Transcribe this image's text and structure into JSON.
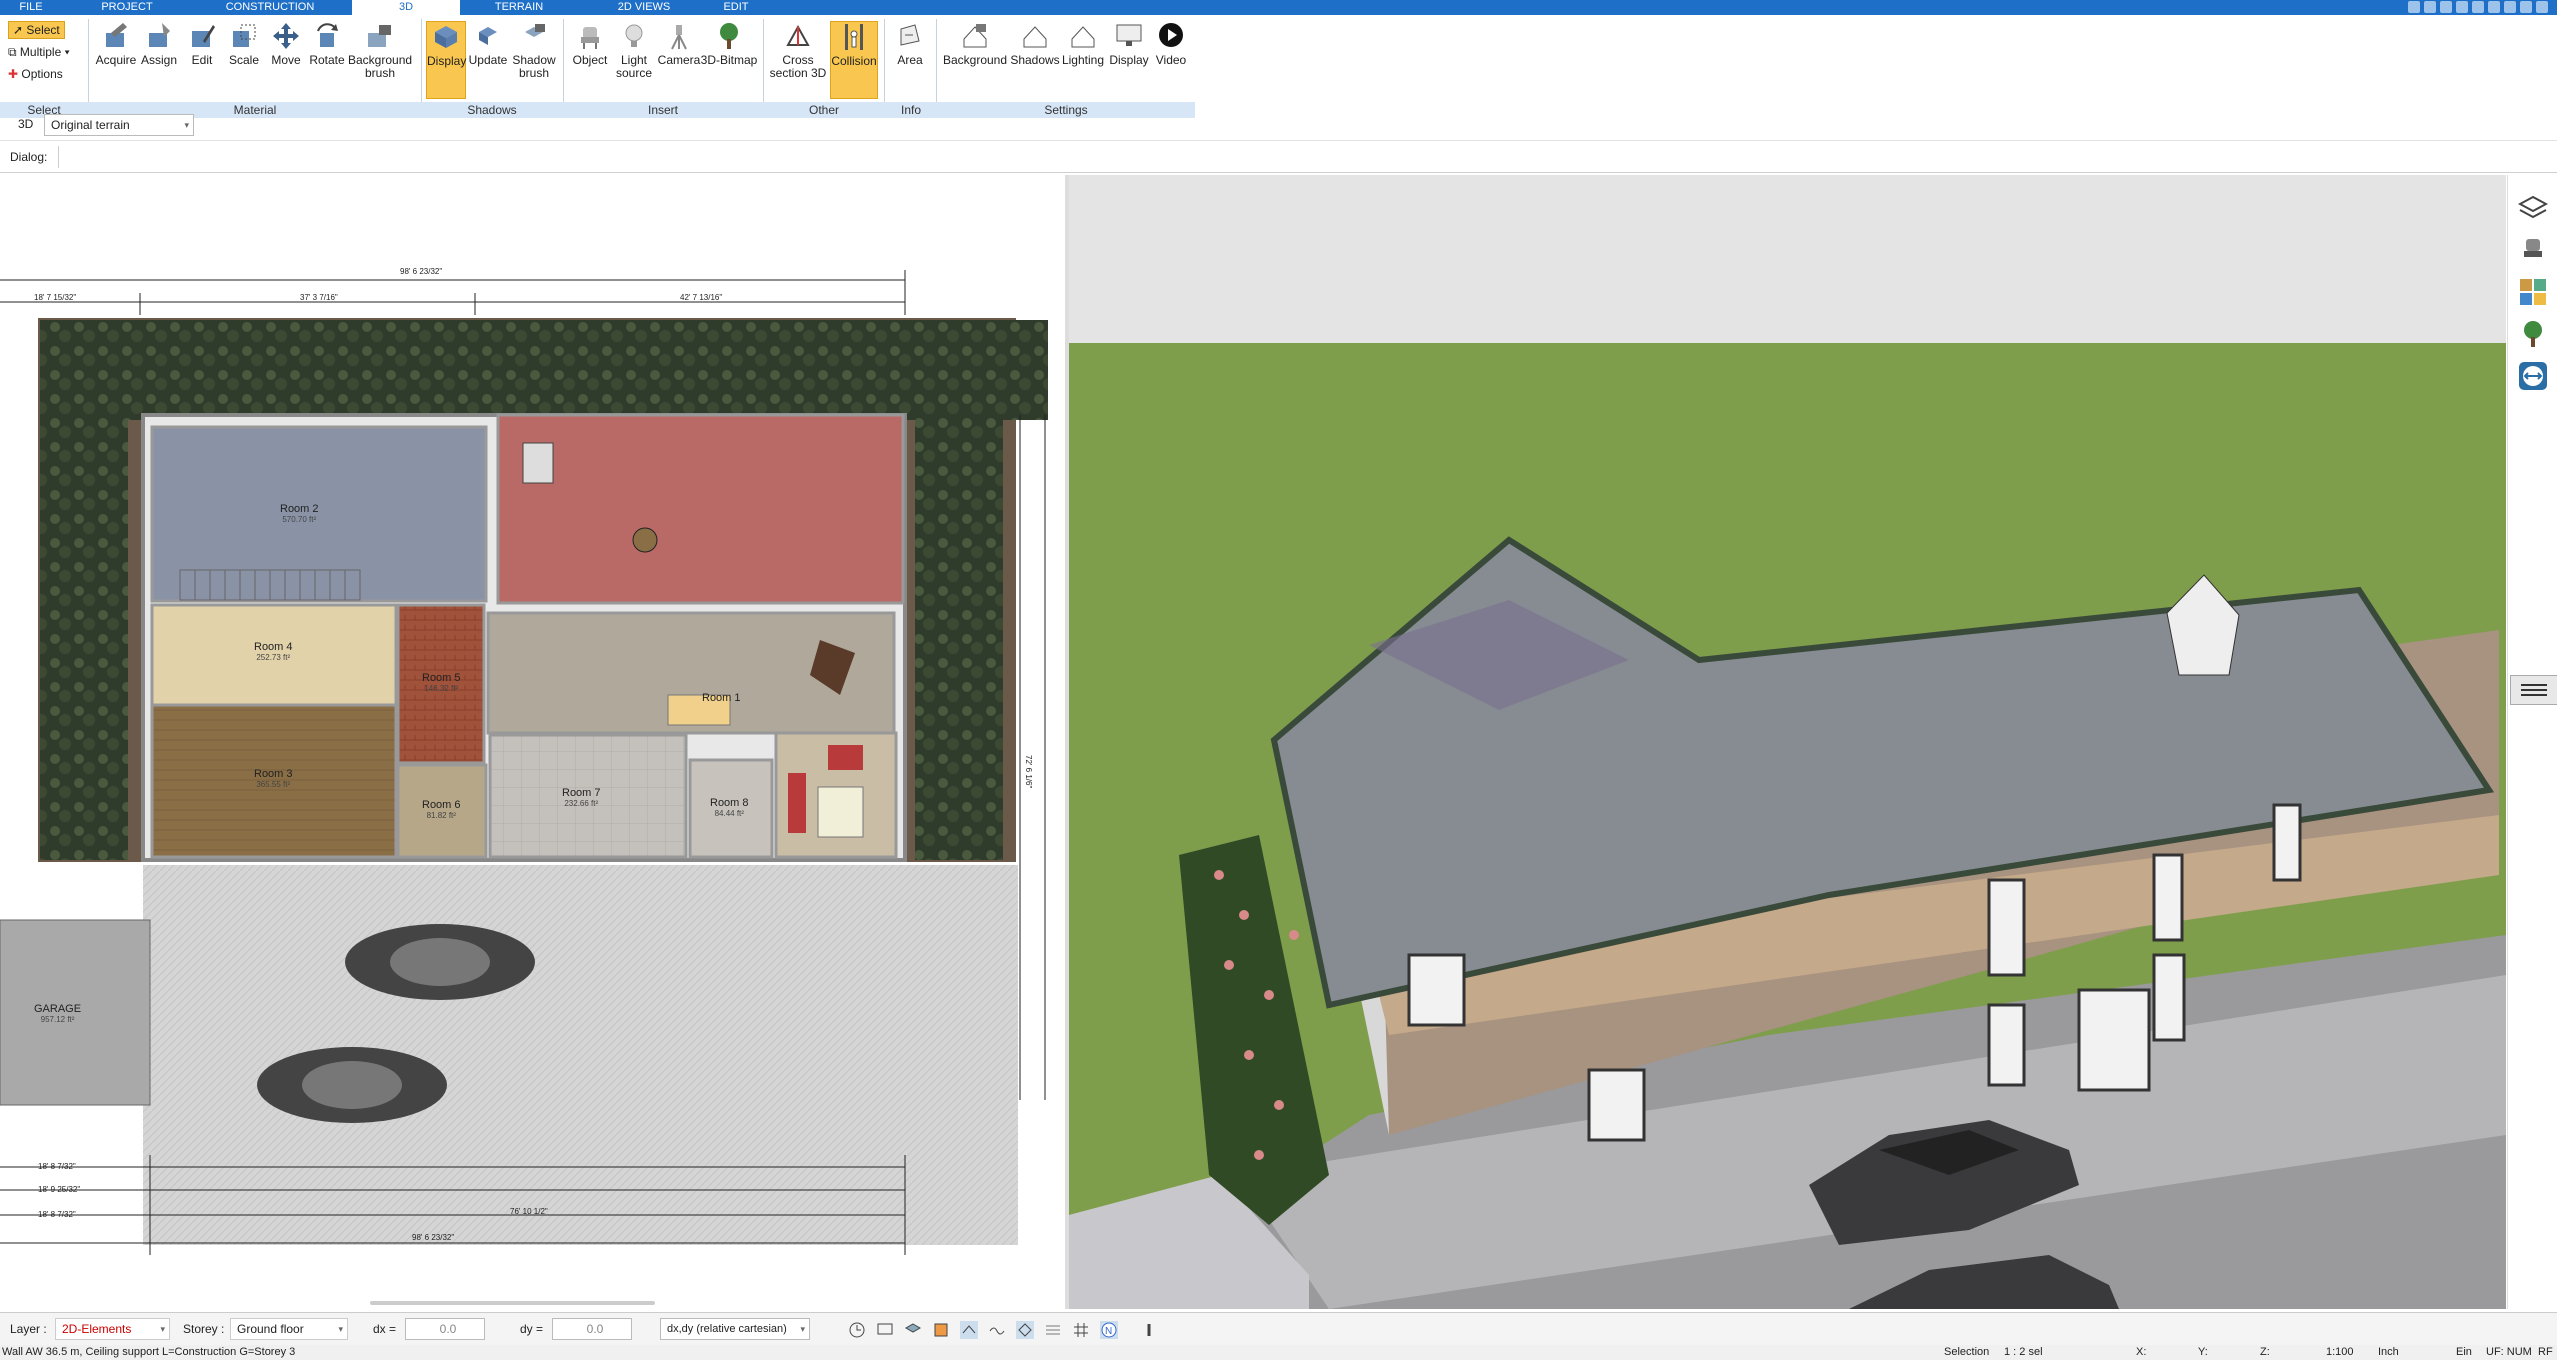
{
  "tabs": [
    {
      "label": "FILE"
    },
    {
      "label": "PROJECT"
    },
    {
      "label": "CONSTRUCTION"
    },
    {
      "label": "3D"
    },
    {
      "label": "TERRAIN"
    },
    {
      "label": "2D VIEWS"
    },
    {
      "label": "EDIT"
    }
  ],
  "ribbon": {
    "select": {
      "select": "Select",
      "multiple": "Multiple",
      "options": "Options"
    },
    "tools": [
      {
        "label": "Acquire",
        "icon": "acquire-icon"
      },
      {
        "label": "Assign",
        "icon": "assign-icon"
      },
      {
        "label": "Edit",
        "icon": "edit-icon"
      },
      {
        "label": "Scale",
        "icon": "scale-icon"
      },
      {
        "label": "Move",
        "icon": "move-icon"
      },
      {
        "label": "Rotate",
        "icon": "rotate-icon"
      },
      {
        "label": "Background brush",
        "icon": "background-brush-icon"
      },
      {
        "label": "Display",
        "icon": "display-shadows-icon"
      },
      {
        "label": "Update",
        "icon": "update-icon"
      },
      {
        "label": "Shadow brush",
        "icon": "shadow-brush-icon"
      },
      {
        "label": "Object",
        "icon": "object-icon"
      },
      {
        "label": "Light source",
        "icon": "light-source-icon"
      },
      {
        "label": "Camera",
        "icon": "camera-icon"
      },
      {
        "label": "3D-Bitmap",
        "icon": "tree-bitmap-icon"
      },
      {
        "label": "Cross section 3D",
        "icon": "cross-section-icon"
      },
      {
        "label": "Collision",
        "icon": "collision-icon"
      },
      {
        "label": "Area",
        "icon": "area-icon"
      },
      {
        "label": "Background",
        "icon": "background-icon"
      },
      {
        "label": "Shadows",
        "icon": "shadows-icon"
      },
      {
        "label": "Lighting",
        "icon": "lighting-icon"
      },
      {
        "label": "Display",
        "icon": "display-icon"
      },
      {
        "label": "Video",
        "icon": "video-icon"
      }
    ],
    "groups": [
      "Select",
      "Material",
      "Shadows",
      "Insert",
      "Other",
      "Info",
      "Settings"
    ]
  },
  "viewbar": {
    "mode": "3D",
    "terrain": "Original terrain",
    "dialog_label": "Dialog:"
  },
  "plan": {
    "rooms": [
      {
        "name": "Room 2",
        "area": "570.70 ft²"
      },
      {
        "name": "Room 4",
        "area": "252.73 ft²"
      },
      {
        "name": "Room 3",
        "area": "365.55 ft²"
      },
      {
        "name": "Room 5",
        "area": "146.32 ft²"
      },
      {
        "name": "Room 6",
        "area": "81.82 ft²"
      },
      {
        "name": "Room 7",
        "area": "232.66 ft²"
      },
      {
        "name": "Room 8",
        "area": "84.44 ft²"
      },
      {
        "name": "Room 1",
        "area": ""
      },
      {
        "name": "GARAGE",
        "area": "957.12 ft²"
      }
    ],
    "dims": {
      "top_total": "98' 6 23/32\"",
      "top_left": "37' 3 7/16\"",
      "top_right": "42' 7 13/16\"",
      "top_margin": "18' 7 15/32\"",
      "bottom_total": "98' 6 23/32\"",
      "bottom_sub": "76' 10 1/2\"",
      "bottom_left": "18' 8 7/32\"",
      "bottom_left2": "18' 9 25/32\"",
      "bottom_left3": "18' 8 7/32\"",
      "right_side": "72' 6 1/6\""
    }
  },
  "bottom": {
    "layer_label": "Layer :",
    "layer_value": "2D-Elements",
    "storey_label": "Storey :",
    "storey_value": "Ground floor",
    "dx_label": "dx =",
    "dx_value": "0.0",
    "dy_label": "dy =",
    "dy_value": "0.0",
    "coord_mode": "dx,dy (relative cartesian)"
  },
  "status": {
    "message": "Wall AW 36.5 m, Ceiling support L=Construction G=Storey 3",
    "selection": "Selection",
    "selection_val": "1 : 2 sel",
    "x": "X:",
    "y": "Y:",
    "z": "Z:",
    "scale": "1:100",
    "unit": "Inch",
    "ein": "Ein",
    "uf": "UF: NUM",
    "rf": "RF"
  },
  "colors": {
    "accent": "#1e6fc8",
    "active_tool": "#f9c74f",
    "grass": "#7f9e4c",
    "sky": "#e4e4e4"
  }
}
